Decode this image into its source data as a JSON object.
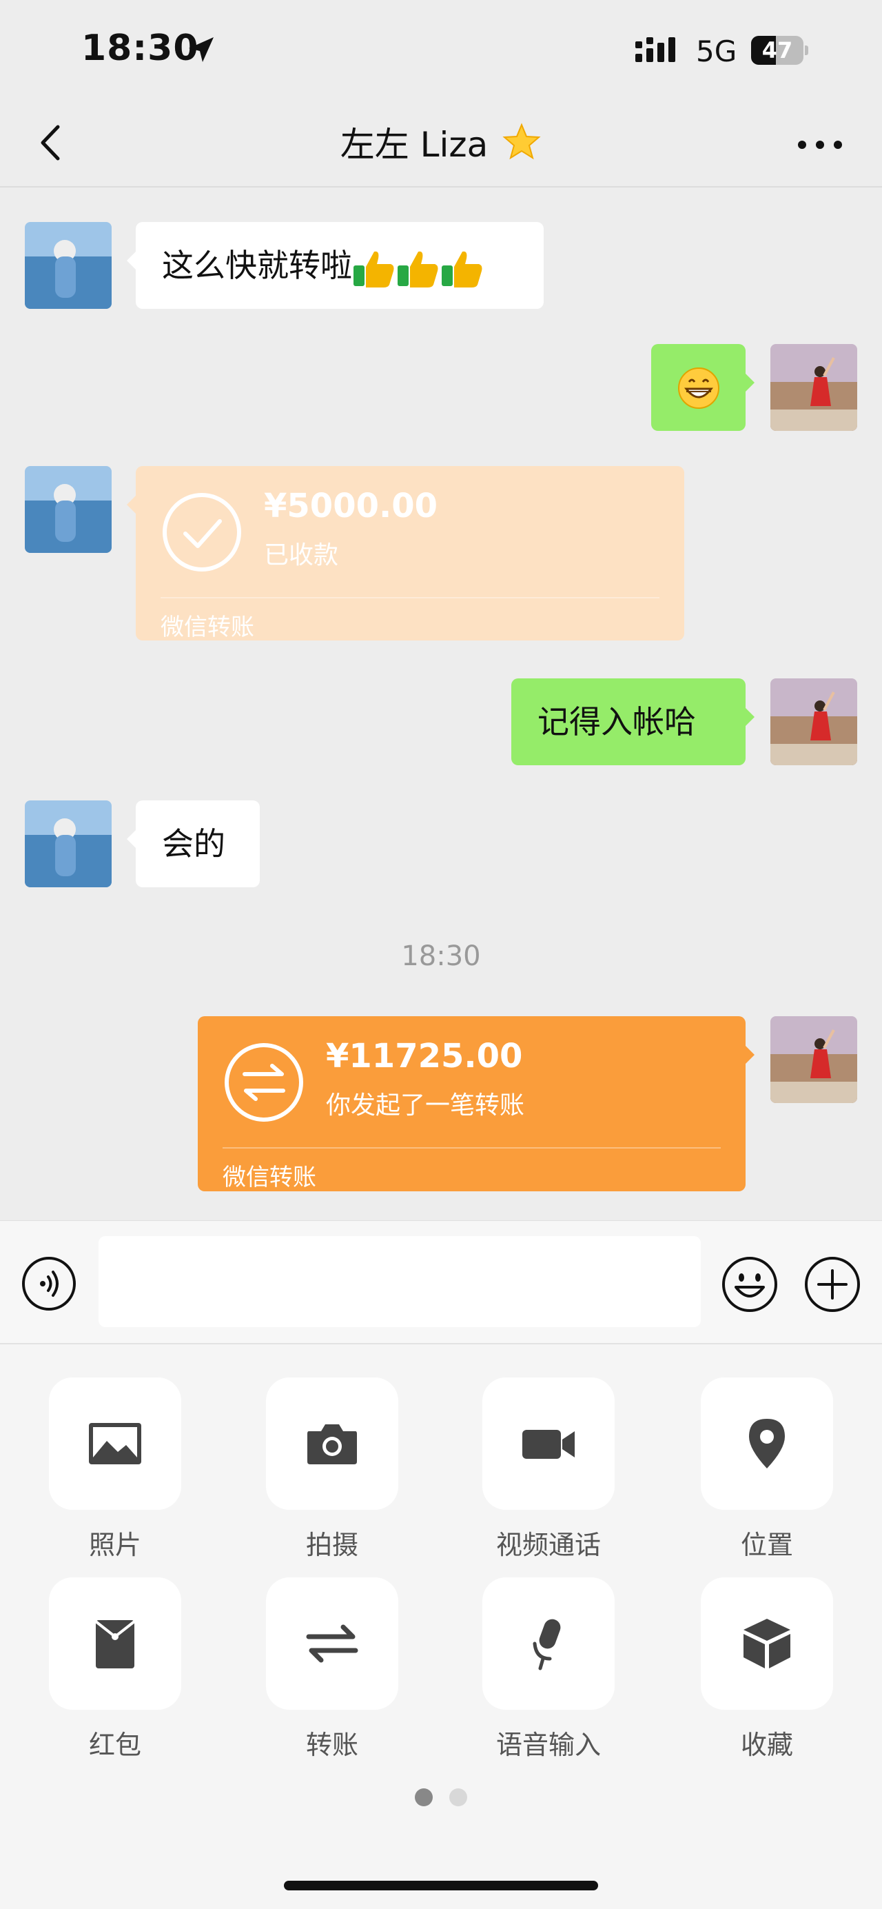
{
  "status_bar": {
    "time": "18:30",
    "network": "5G",
    "battery": "47",
    "battery_level": 0.47
  },
  "nav": {
    "title": "左左 Liza",
    "title_icon": "star-icon",
    "back_icon": "chevron-left-icon",
    "more_icon": "more-icon"
  },
  "messages": [
    {
      "side": "left",
      "type": "text",
      "text": "这么快就转啦",
      "icons": [
        "thumbs-up-icon",
        "thumbs-up-icon",
        "thumbs-up-icon"
      ]
    },
    {
      "side": "right",
      "type": "emoji",
      "icon": "grin-emoji-icon"
    },
    {
      "side": "left",
      "type": "transfer",
      "amount": "¥5000.00",
      "status": "已收款",
      "footer": "微信转账",
      "state": "received"
    },
    {
      "side": "right",
      "type": "text",
      "text": "记得入帐哈"
    },
    {
      "side": "left",
      "type": "text",
      "text": "会的"
    },
    {
      "type": "time",
      "text": "18:30"
    },
    {
      "side": "right",
      "type": "transfer",
      "amount": "¥11725.00",
      "status": "你发起了一笔转账",
      "footer": "微信转账",
      "state": "pending"
    }
  ],
  "input_bar": {
    "placeholder": "",
    "value": ""
  },
  "panel": {
    "items": [
      {
        "label": "照片",
        "icon": "photo-icon"
      },
      {
        "label": "拍摄",
        "icon": "camera-icon"
      },
      {
        "label": "视频通话",
        "icon": "video-call-icon"
      },
      {
        "label": "位置",
        "icon": "location-icon"
      },
      {
        "label": "红包",
        "icon": "red-packet-icon"
      },
      {
        "label": "转账",
        "icon": "transfer-icon"
      },
      {
        "label": "语音输入",
        "icon": "microphone-icon"
      },
      {
        "label": "收藏",
        "icon": "favorites-icon"
      }
    ],
    "page": 1,
    "page_count": 2
  },
  "colors": {
    "chat_background": "#ededed",
    "self_bubble": "#95ec69",
    "transfer_sent": "#fa9d3b",
    "transfer_received": "#fde1c3"
  }
}
